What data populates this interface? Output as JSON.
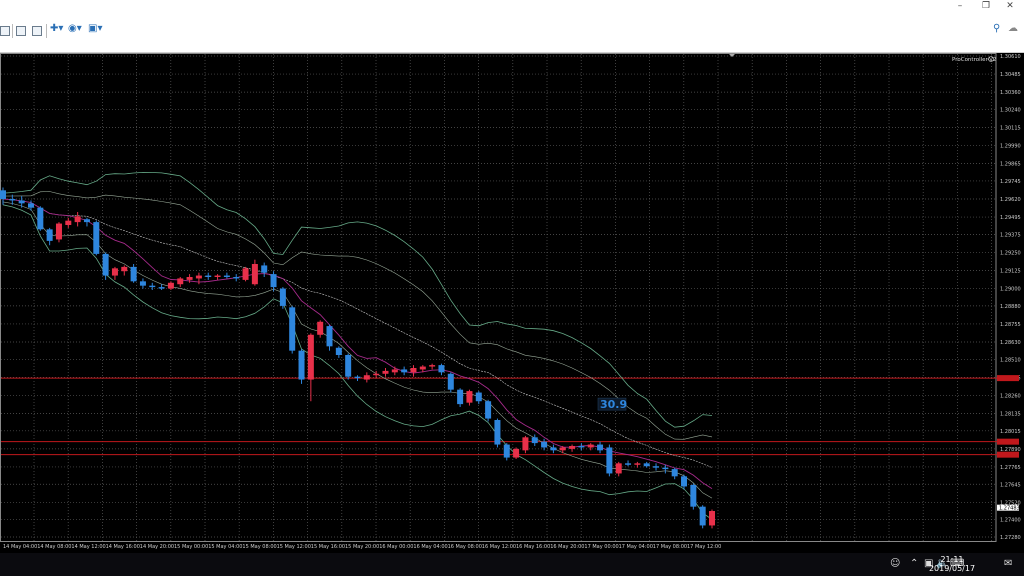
{
  "window": {
    "minimize_icon": "minimize-icon",
    "restore_icon": "restore-icon",
    "close_icon": "close-icon"
  },
  "toolbar": {
    "search_icon": "search-icon",
    "chat_icon": "chat-icon"
  },
  "chart": {
    "indicator_label": "ProController-V2",
    "overlay_value": "30.9",
    "price_ticks": [
      "1.30610",
      "1.30485",
      "1.30360",
      "1.30240",
      "1.30115",
      "1.29990",
      "1.29865",
      "1.29745",
      "1.29620",
      "1.29495",
      "1.29375",
      "1.29250",
      "1.29125",
      "1.29000",
      "1.28880",
      "1.28755",
      "1.28630",
      "1.28510",
      "1.28385",
      "1.28260",
      "1.28135",
      "1.28015",
      "1.27890",
      "1.27765",
      "1.27645",
      "1.27520",
      "1.27400",
      "1.27280"
    ],
    "time_ticks": [
      "14 May 04:00",
      "14 May 08:00",
      "14 May 12:00",
      "14 May 16:00",
      "14 May 20:00",
      "15 May 00:00",
      "15 May 04:00",
      "15 May 08:00",
      "15 May 12:00",
      "15 May 16:00",
      "15 May 20:00",
      "16 May 00:00",
      "16 May 04:00",
      "16 May 08:00",
      "16 May 12:00",
      "16 May 16:00",
      "16 May 20:00",
      "17 May 00:00",
      "17 May 04:00",
      "17 May 08:00",
      "17 May 12:00"
    ],
    "current_price": "1.27483",
    "levels": [
      1.2838,
      1.2794,
      1.2785
    ],
    "colors": {
      "bull": "#2e86de",
      "bear": "#e8304a",
      "grid": "#5a5a5a",
      "band": "#66aa88",
      "ma": "#a52a8a",
      "level": "#c0181c"
    },
    "candles": [
      [
        1.2968,
        1.297,
        1.2958,
        1.2962
      ],
      [
        1.2962,
        1.2965,
        1.2958,
        1.2961
      ],
      [
        1.2961,
        1.2964,
        1.2956,
        1.2959
      ],
      [
        1.2959,
        1.2961,
        1.2954,
        1.2956
      ],
      [
        1.2956,
        1.2957,
        1.294,
        1.2941
      ],
      [
        1.2941,
        1.2942,
        1.293,
        1.2933
      ],
      [
        1.2934,
        1.2946,
        1.2932,
        1.2945
      ],
      [
        1.2944,
        1.2949,
        1.2942,
        1.2947
      ],
      [
        1.2946,
        1.2953,
        1.2943,
        1.295
      ],
      [
        1.2948,
        1.2949,
        1.2943,
        1.2946
      ],
      [
        1.2946,
        1.2947,
        1.2923,
        1.2924
      ],
      [
        1.2924,
        1.2925,
        1.2906,
        1.2909
      ],
      [
        1.2909,
        1.2915,
        1.2906,
        1.2914
      ],
      [
        1.2912,
        1.2916,
        1.2909,
        1.2915
      ],
      [
        1.2915,
        1.2917,
        1.2904,
        1.2905
      ],
      [
        1.2905,
        1.2907,
        1.29,
        1.2902
      ],
      [
        1.2902,
        1.2904,
        1.2899,
        1.2901
      ],
      [
        1.2901,
        1.2903,
        1.2899,
        1.29
      ],
      [
        1.29,
        1.2905,
        1.2899,
        1.2904
      ],
      [
        1.2903,
        1.2908,
        1.2901,
        1.2907
      ],
      [
        1.2906,
        1.291,
        1.2904,
        1.2908
      ],
      [
        1.2907,
        1.2911,
        1.2903,
        1.2909
      ],
      [
        1.2909,
        1.2911,
        1.2906,
        1.2908
      ],
      [
        1.2908,
        1.291,
        1.2906,
        1.2909
      ],
      [
        1.2909,
        1.2911,
        1.2907,
        1.2908
      ],
      [
        1.2908,
        1.291,
        1.2905,
        1.2907
      ],
      [
        1.2906,
        1.2915,
        1.2905,
        1.2914
      ],
      [
        1.2903,
        1.292,
        1.2902,
        1.2917
      ],
      [
        1.2916,
        1.2918,
        1.2908,
        1.2911
      ],
      [
        1.291,
        1.2912,
        1.2898,
        1.2901
      ],
      [
        1.29,
        1.2901,
        1.2886,
        1.2888
      ],
      [
        1.2887,
        1.2888,
        1.2855,
        1.2857
      ],
      [
        1.2857,
        1.2858,
        1.2834,
        1.2837
      ],
      [
        1.2837,
        1.2869,
        1.2822,
        1.2868
      ],
      [
        1.2868,
        1.2878,
        1.2866,
        1.2877
      ],
      [
        1.2874,
        1.2875,
        1.2857,
        1.286
      ],
      [
        1.2859,
        1.286,
        1.2852,
        1.2854
      ],
      [
        1.2854,
        1.2855,
        1.2837,
        1.2839
      ],
      [
        1.2839,
        1.284,
        1.2836,
        1.2838
      ],
      [
        1.2837,
        1.2842,
        1.2835,
        1.284
      ],
      [
        1.284,
        1.2843,
        1.2838,
        1.2841
      ],
      [
        1.2841,
        1.2845,
        1.2839,
        1.2843
      ],
      [
        1.2842,
        1.2846,
        1.284,
        1.2844
      ],
      [
        1.2844,
        1.2846,
        1.284,
        1.2842
      ],
      [
        1.2842,
        1.2847,
        1.2839,
        1.2845
      ],
      [
        1.2844,
        1.2847,
        1.2842,
        1.2846
      ],
      [
        1.2846,
        1.2848,
        1.2844,
        1.2847
      ],
      [
        1.2847,
        1.2848,
        1.284,
        1.2842
      ],
      [
        1.2841,
        1.2842,
        1.2828,
        1.283
      ],
      [
        1.283,
        1.2831,
        1.2818,
        1.282
      ],
      [
        1.2821,
        1.283,
        1.2819,
        1.2829
      ],
      [
        1.2828,
        1.2829,
        1.282,
        1.2822
      ],
      [
        1.2822,
        1.2823,
        1.2808,
        1.281
      ],
      [
        1.2809,
        1.281,
        1.279,
        1.2792
      ],
      [
        1.2792,
        1.2793,
        1.2781,
        1.2783
      ],
      [
        1.2783,
        1.279,
        1.2782,
        1.2789
      ],
      [
        1.2788,
        1.2798,
        1.2786,
        1.2797
      ],
      [
        1.2797,
        1.2799,
        1.2791,
        1.2793
      ],
      [
        1.2794,
        1.2796,
        1.2788,
        1.279
      ],
      [
        1.279,
        1.2792,
        1.2786,
        1.2788
      ],
      [
        1.2788,
        1.2791,
        1.2786,
        1.279
      ],
      [
        1.2789,
        1.2792,
        1.2787,
        1.2791
      ],
      [
        1.2791,
        1.2793,
        1.2788,
        1.279
      ],
      [
        1.279,
        1.2793,
        1.2788,
        1.2792
      ],
      [
        1.2792,
        1.2794,
        1.2786,
        1.2788
      ],
      [
        1.279,
        1.2792,
        1.277,
        1.2772
      ],
      [
        1.2772,
        1.278,
        1.277,
        1.2779
      ],
      [
        1.2779,
        1.2781,
        1.2777,
        1.2778
      ],
      [
        1.2778,
        1.278,
        1.2776,
        1.2779
      ],
      [
        1.2779,
        1.278,
        1.2776,
        1.2777
      ],
      [
        1.2777,
        1.2779,
        1.2774,
        1.2776
      ],
      [
        1.2776,
        1.2778,
        1.2772,
        1.2775
      ],
      [
        1.2775,
        1.2776,
        1.2768,
        1.277
      ],
      [
        1.277,
        1.2771,
        1.2761,
        1.2763
      ],
      [
        1.2764,
        1.2765,
        1.2747,
        1.2749
      ],
      [
        1.2749,
        1.275,
        1.2734,
        1.2736
      ],
      [
        1.2736,
        1.2747,
        1.2734,
        1.2746
      ]
    ]
  },
  "taskbar": {
    "time": "21:11",
    "date": "2019/05/17"
  }
}
